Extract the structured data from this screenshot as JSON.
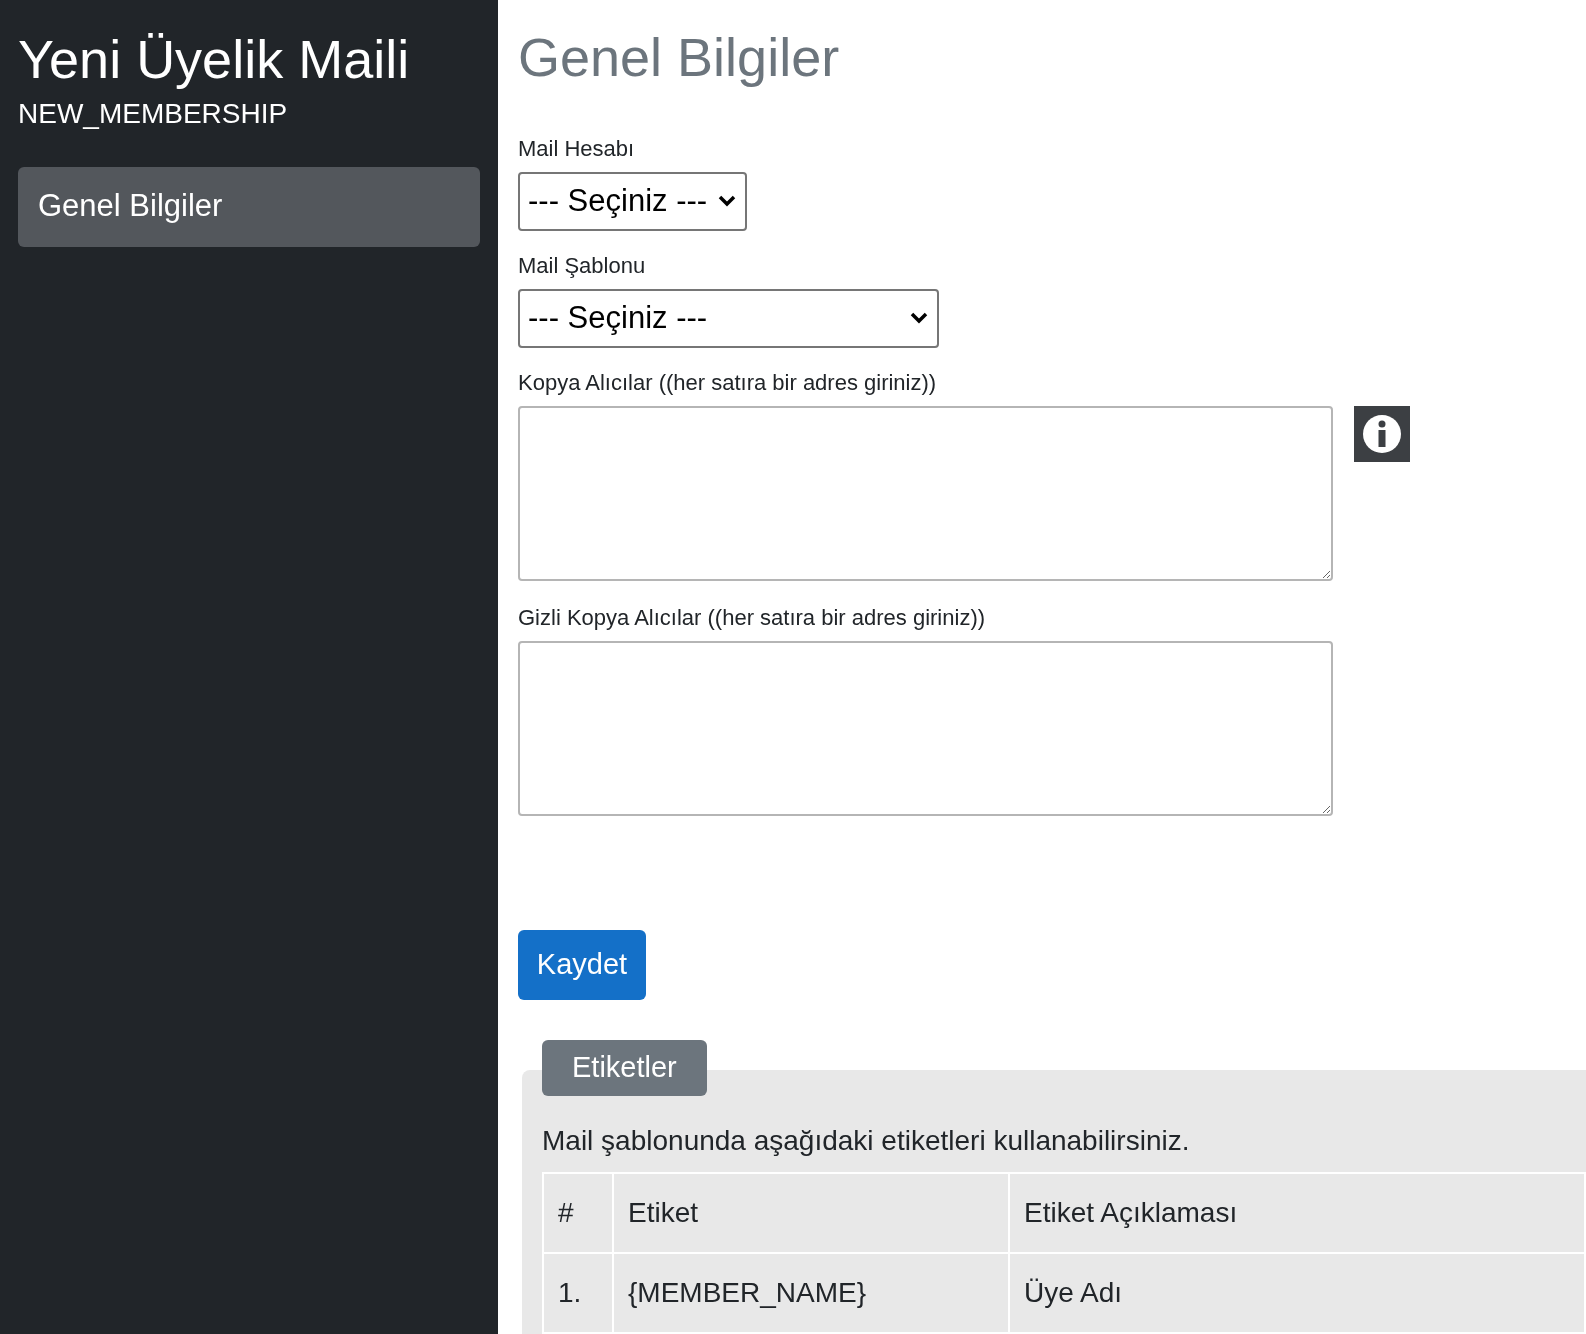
{
  "sidebar": {
    "title": "Yeni Üyelik Maili",
    "code": "NEW_MEMBERSHIP",
    "items": [
      {
        "label": "Genel Bilgiler",
        "selected": true
      }
    ]
  },
  "main": {
    "heading": "Genel Bilgiler",
    "fields": [
      {
        "kind": "select",
        "label": "Mail Hesabı",
        "value": "--- Seçiniz ---",
        "wide": false
      },
      {
        "kind": "select",
        "label": "Mail Şablonu",
        "value": "--- Seçiniz ---",
        "wide": true
      },
      {
        "kind": "textarea",
        "label": "Kopya Alıcılar ((her satıra bir adres giriniz))",
        "info": true
      },
      {
        "kind": "textarea",
        "label": "Gizli Kopya Alıcılar ((her satıra bir adres giriniz))",
        "info": false
      }
    ],
    "save_button": "Kaydet"
  },
  "tags": {
    "tab": "Etiketler",
    "intro": "Mail şablonunda aşağıdaki etiketleri kullanabilirsiniz.",
    "columns": [
      "#",
      "Etiket",
      "Etiket Açıklaması"
    ],
    "rows": [
      [
        "1.",
        "{MEMBER_NAME}",
        "Üye Adı"
      ]
    ]
  }
}
